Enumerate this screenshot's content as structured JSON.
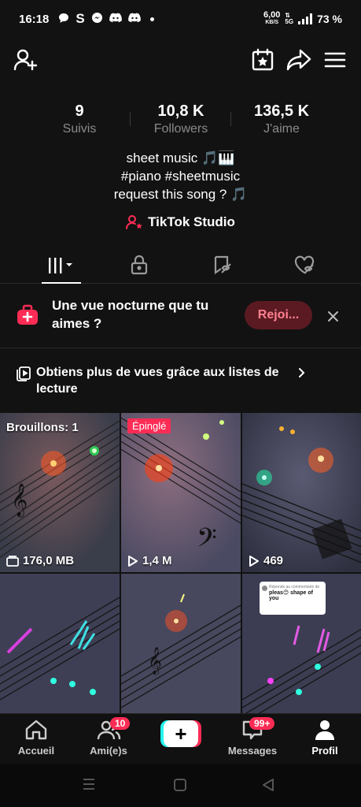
{
  "status_bar": {
    "time": "16:18",
    "app_letter": "S",
    "net_speed_value": "6,00",
    "net_speed_unit": "KB/S",
    "network_type": "5G",
    "battery": "73 %"
  },
  "stats": {
    "following_count": "9",
    "following_label": "Suivis",
    "followers_count": "10,8 K",
    "followers_label": "Followers",
    "likes_count": "136,5 K",
    "likes_label": "J'aime"
  },
  "bio": {
    "line1": "sheet music 🎵🎹",
    "line2": "#piano #sheetmusic",
    "line3": "request this song ? 🎵"
  },
  "studio": {
    "label": "TikTok Studio"
  },
  "banner": {
    "text": "Une vue nocturne que tu aimes ?",
    "join_label": "Rejoi..."
  },
  "playlist": {
    "text": "Obtiens plus de vues grâce aux listes de lecture"
  },
  "grid": {
    "items": [
      {
        "top_label": "Brouillons: 1",
        "bottom_label": "176,0 MB",
        "icon": "draft-icon"
      },
      {
        "pinned_label": "Épinglé",
        "bottom_label": "1,4 M",
        "icon": "play-icon"
      },
      {
        "bottom_label": "469",
        "icon": "play-icon"
      },
      {
        "bottom_label": ""
      },
      {
        "bottom_label": ""
      },
      {
        "comment_header": "Réponds au commentaire de ",
        "comment_text": "pleas😊 shape of you",
        "bottom_label": ""
      }
    ]
  },
  "bottom_nav": {
    "home": "Accueil",
    "friends": "Ami(e)s",
    "friends_badge": "10",
    "messages": "Messages",
    "messages_badge": "99+",
    "profile": "Profil"
  },
  "colors": {
    "accent": "#fe2c55",
    "background": "#121212",
    "join_bg": "#5b1a22",
    "cyan": "#25f4ee"
  }
}
